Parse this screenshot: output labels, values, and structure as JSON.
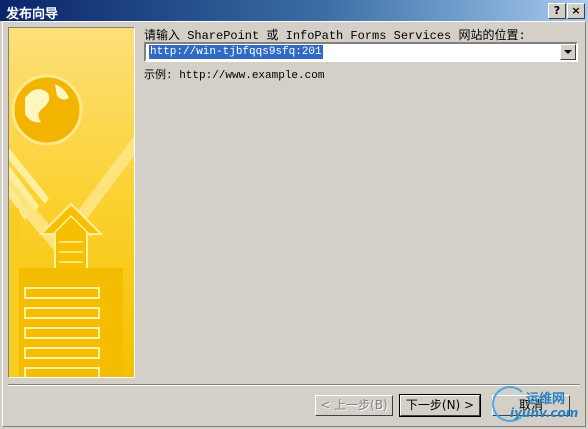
{
  "window": {
    "title": "发布向导",
    "help_label": "?",
    "close_label": "×"
  },
  "content": {
    "prompt": "请输入 SharePoint 或 InfoPath Forms Services 网站的位置:",
    "url_value": "http://win-tjbfqqs9sfq:201",
    "example": "示例: http://www.example.com"
  },
  "buttons": {
    "back": "< 上一步(B)",
    "next": "下一步(N) >",
    "cancel": "取消"
  },
  "watermark": {
    "text1": "运维网",
    "text2": "iyunv.com"
  }
}
